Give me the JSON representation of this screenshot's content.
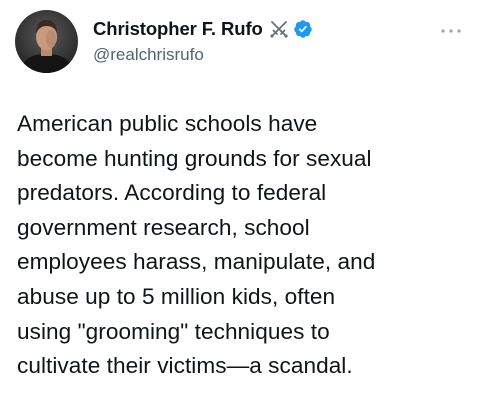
{
  "author": {
    "display_name": "Christopher F. Rufo",
    "handle": "@realchrisrufo",
    "name_emoji_icon": "crossed-swords-icon",
    "verified_icon": "verified-badge-icon"
  },
  "menu": {
    "icon": "more-horizontal-icon"
  },
  "tweet": {
    "lines": [
      "American public schools have",
      "become hunting grounds for sexual",
      "predators. According to federal",
      "government research, school",
      "employees harass, manipulate, and",
      "abuse up to 5 million kids, often",
      "using \"grooming\" techniques to",
      "cultivate their victims—a scandal."
    ]
  },
  "colors": {
    "text_primary": "#0f1419",
    "text_secondary": "#536471",
    "verified_blue": "#1d9bf0",
    "background": "#ffffff"
  }
}
